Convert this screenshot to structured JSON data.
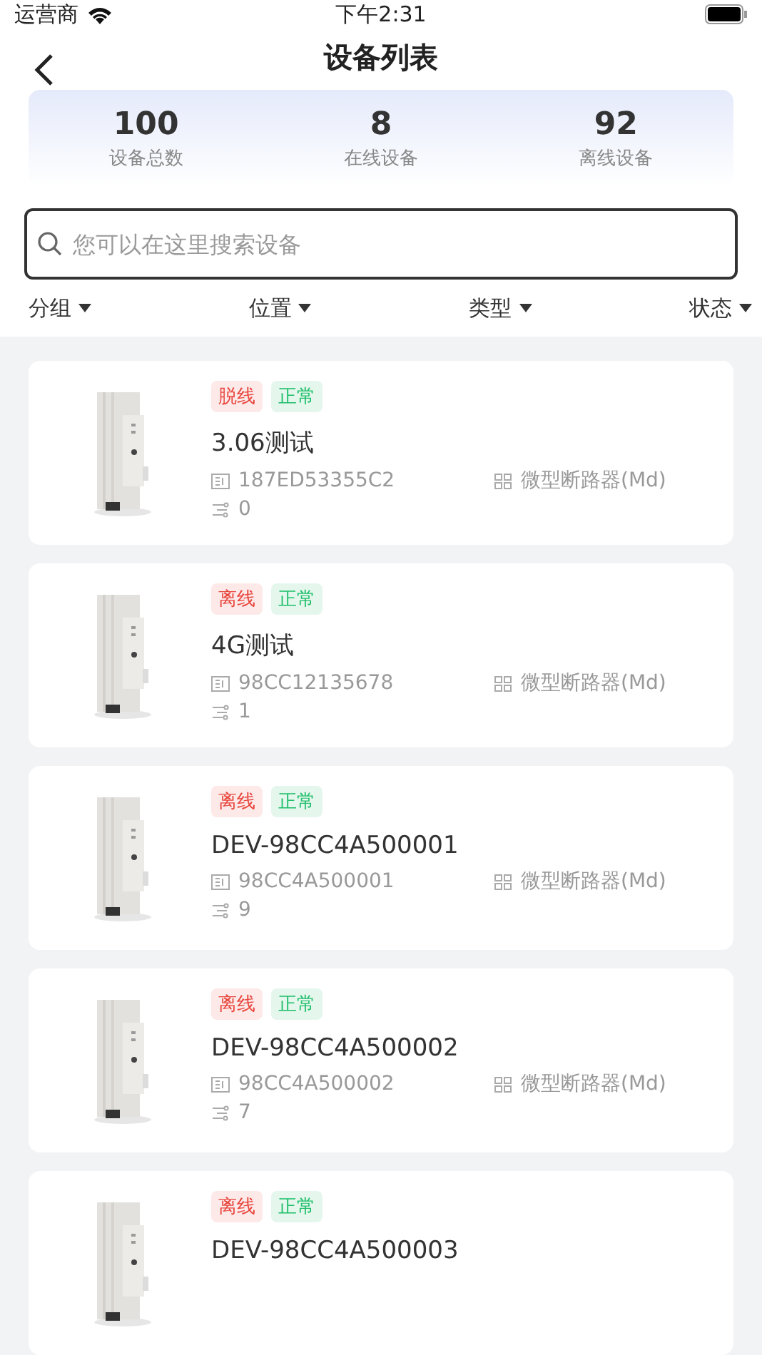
{
  "status_bar": {
    "carrier": "运营商",
    "time": "下午2:31"
  },
  "nav": {
    "title": "设备列表"
  },
  "stats": [
    {
      "value": "100",
      "label": "设备总数"
    },
    {
      "value": "8",
      "label": "在线设备"
    },
    {
      "value": "92",
      "label": "离线设备"
    }
  ],
  "search": {
    "placeholder": "您可以在这里搜索设备"
  },
  "filters": [
    "分组",
    "位置",
    "类型",
    "状态"
  ],
  "devices": [
    {
      "tags": [
        {
          "label": "脱线",
          "color": "#e8453c"
        },
        {
          "label": "正常",
          "color": "#1fbf6a"
        }
      ],
      "name": "3.06测试",
      "id": "187ED53355C2",
      "type": "微型断路器(Md)",
      "count": "0"
    },
    {
      "tags": [
        {
          "label": "离线",
          "color": "#e8453c"
        },
        {
          "label": "正常",
          "color": "#1fbf6a"
        }
      ],
      "name": "4G测试",
      "id": "98CC12135678",
      "type": "微型断路器(Md)",
      "count": "1"
    },
    {
      "tags": [
        {
          "label": "离线",
          "color": "#e8453c"
        },
        {
          "label": "正常",
          "color": "#1fbf6a"
        }
      ],
      "name": "DEV-98CC4A500001",
      "id": "98CC4A500001",
      "type": "微型断路器(Md)",
      "count": "9"
    },
    {
      "tags": [
        {
          "label": "离线",
          "color": "#e8453c"
        },
        {
          "label": "正常",
          "color": "#1fbf6a"
        }
      ],
      "name": "DEV-98CC4A500002",
      "id": "98CC4A500002",
      "type": "微型断路器(Md)",
      "count": "7"
    },
    {
      "tags": [
        {
          "label": "离线",
          "color": "#e8453c"
        },
        {
          "label": "正常",
          "color": "#1fbf6a"
        }
      ],
      "name": "DEV-98CC4A500003"
    }
  ]
}
